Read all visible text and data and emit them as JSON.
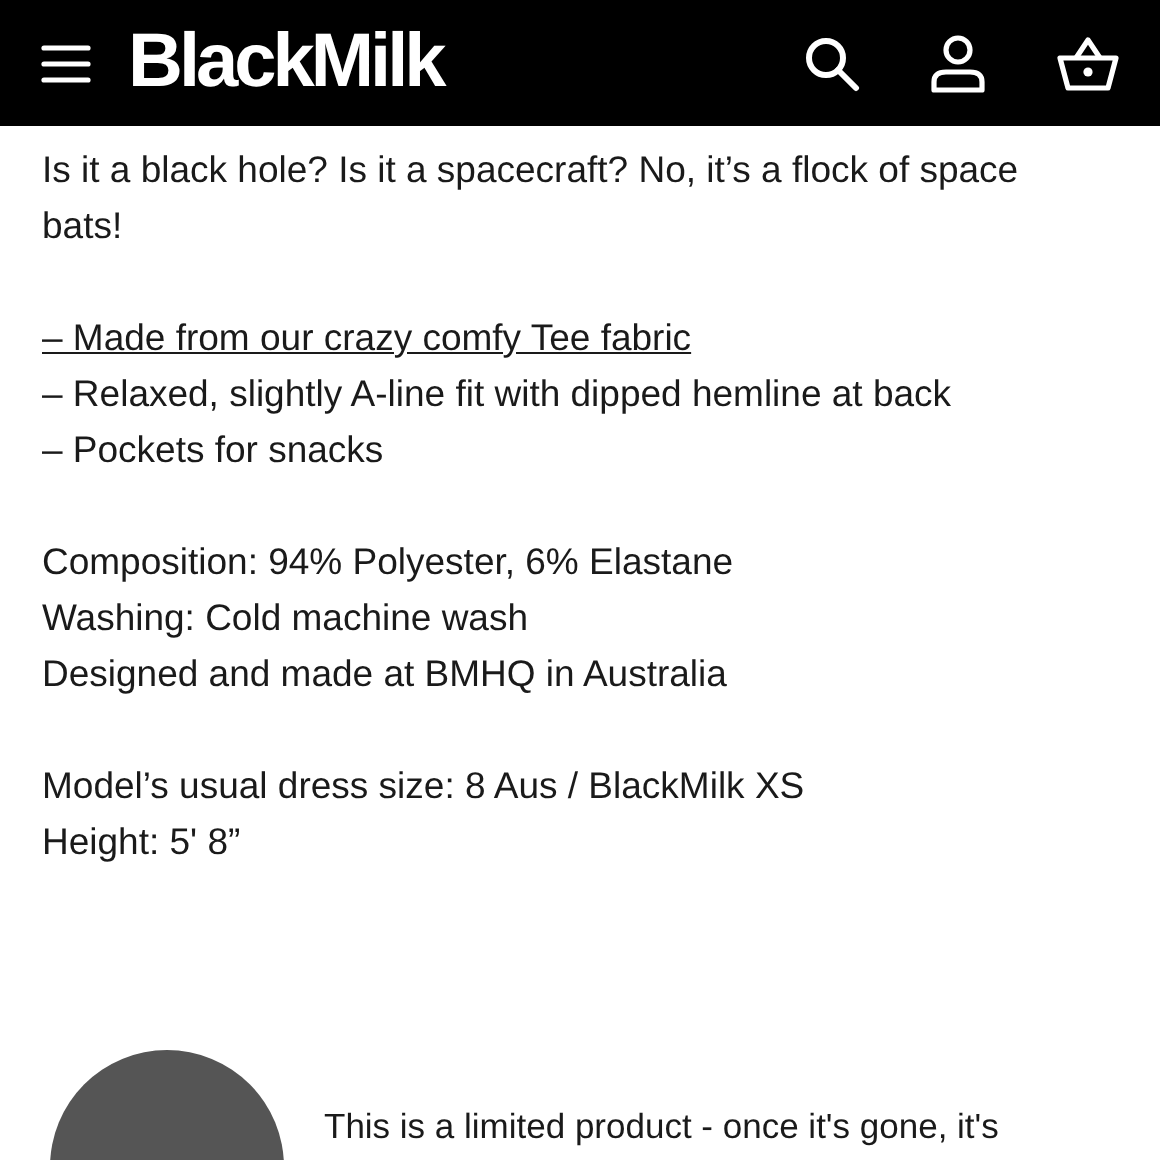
{
  "header": {
    "logo": "BlackMilk"
  },
  "description": [
    {
      "lines": [
        {
          "kind": "text",
          "text": "Is it a black hole? Is it a spacecraft? No, it’s a flock of space bats!"
        }
      ]
    },
    {
      "lines": [
        {
          "kind": "link",
          "text": "– Made from our crazy comfy Tee fabric"
        },
        {
          "kind": "text",
          "text": "– Relaxed, slightly A-line fit with dipped hemline at back"
        },
        {
          "kind": "text",
          "text": "– Pockets for snacks"
        }
      ]
    },
    {
      "lines": [
        {
          "kind": "text",
          "text": "Composition: 94% Polyester, 6% Elastane"
        },
        {
          "kind": "text",
          "text": "Washing: Cold machine wash"
        },
        {
          "kind": "text",
          "text": "Designed and made at BMHQ in Australia"
        }
      ]
    },
    {
      "lines": [
        {
          "kind": "text",
          "text": "Model’s usual dress size: 8 Aus / BlackMilk XS"
        },
        {
          "kind": "text",
          "text": "Height: 5' 8”"
        }
      ]
    }
  ],
  "notice": {
    "text": "This is a limited product - once it's gone, it's"
  }
}
